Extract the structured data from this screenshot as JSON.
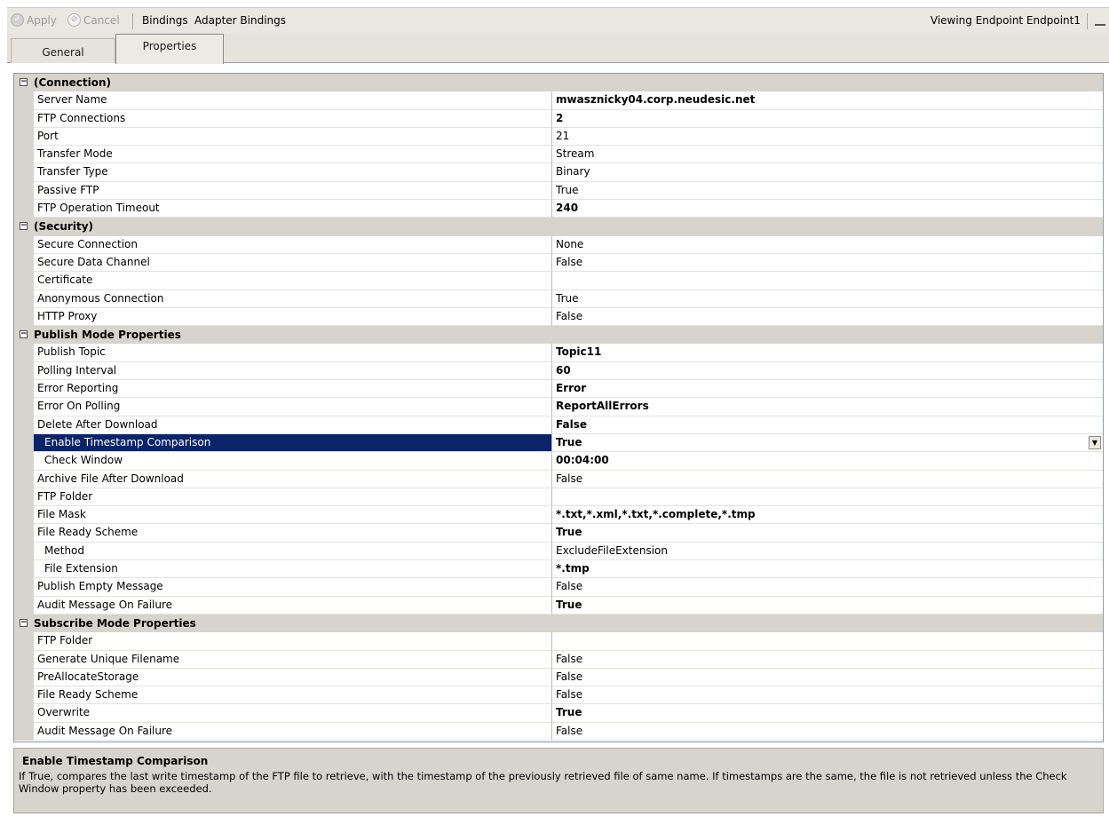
{
  "toolbar": {
    "apply_label": "Apply",
    "cancel_label": "Cancel",
    "bindings_label": "Bindings",
    "adapter_bindings_label": "Adapter Bindings",
    "viewing_text": "Viewing Endpoint Endpoint1"
  },
  "tabs": [
    {
      "label": "General",
      "selected": false
    },
    {
      "label": "Properties",
      "selected": true
    }
  ],
  "grid": {
    "categories": [
      {
        "label": "(Connection)",
        "expanded": true,
        "rows": [
          {
            "name": "Server Name",
            "value": "mwasznicky04.corp.neudesic.net",
            "bold": true
          },
          {
            "name": "FTP Connections",
            "value": "2",
            "bold": true
          },
          {
            "name": "Port",
            "value": "21"
          },
          {
            "name": "Transfer Mode",
            "value": "Stream"
          },
          {
            "name": "Transfer Type",
            "value": "Binary"
          },
          {
            "name": "Passive FTP",
            "value": "True"
          },
          {
            "name": "FTP Operation Timeout",
            "value": "240",
            "bold": true
          }
        ]
      },
      {
        "label": "(Security)",
        "expanded": true,
        "rows": [
          {
            "name": "Secure Connection",
            "value": "None"
          },
          {
            "name": "Secure Data Channel",
            "value": "False"
          },
          {
            "name": "Certificate",
            "value": ""
          },
          {
            "name": "Anonymous Connection",
            "value": "True"
          },
          {
            "name": "HTTP Proxy",
            "value": "False"
          }
        ]
      },
      {
        "label": "Publish Mode Properties",
        "expanded": true,
        "rows": [
          {
            "name": "Publish Topic",
            "value": "Topic11",
            "bold": true
          },
          {
            "name": "Polling Interval",
            "value": "60",
            "bold": true
          },
          {
            "name": "Error Reporting",
            "value": "Error",
            "bold": true
          },
          {
            "name": "Error On Polling",
            "value": "ReportAllErrors",
            "bold": true
          },
          {
            "name": "Delete After Download",
            "value": "False",
            "bold": true
          },
          {
            "name": "Enable Timestamp Comparison",
            "value": "True",
            "bold": true,
            "sub": true,
            "selected": true,
            "dropdown": true
          },
          {
            "name": "Check Window",
            "value": "00:04:00",
            "bold": true,
            "sub": true
          },
          {
            "name": "Archive File After Download",
            "value": "False"
          },
          {
            "name": "FTP Folder",
            "value": ""
          },
          {
            "name": "File Mask",
            "value": "*.txt,*.xml,*.txt,*.complete,*.tmp",
            "bold": true
          },
          {
            "name": "File Ready Scheme",
            "value": "True",
            "bold": true
          },
          {
            "name": "Method",
            "value": "ExcludeFileExtension",
            "sub": true
          },
          {
            "name": "File Extension",
            "value": "*.tmp",
            "bold": true,
            "sub": true
          },
          {
            "name": "Publish Empty Message",
            "value": "False"
          },
          {
            "name": "Audit Message On Failure",
            "value": "True",
            "bold": true
          }
        ]
      },
      {
        "label": "Subscribe Mode Properties",
        "expanded": true,
        "rows": [
          {
            "name": "FTP Folder",
            "value": ""
          },
          {
            "name": "Generate Unique Filename",
            "value": "False"
          },
          {
            "name": "PreAllocateStorage",
            "value": "False"
          },
          {
            "name": "File Ready Scheme",
            "value": "False"
          },
          {
            "name": "Overwrite",
            "value": "True",
            "bold": true
          },
          {
            "name": "Audit Message On Failure",
            "value": "False"
          }
        ]
      }
    ]
  },
  "help": {
    "title": "Enable Timestamp Comparison",
    "text": "If True, compares the last write timestamp of the FTP file to retrieve, with the timestamp of the previously retrieved file of same name. If timestamps are the same, the file is not retrieved unless the Check Window property has been exceeded."
  },
  "icons": {
    "apply": "check-circle-icon",
    "cancel": "cancel-circle-icon",
    "category_toggle": "collapse-minus-icon",
    "dropdown": "dropdown-arrow-icon",
    "minimize": "minimize-icon"
  },
  "colors": {
    "selection": "#0a246a",
    "category_band": "#d6d4cc"
  }
}
